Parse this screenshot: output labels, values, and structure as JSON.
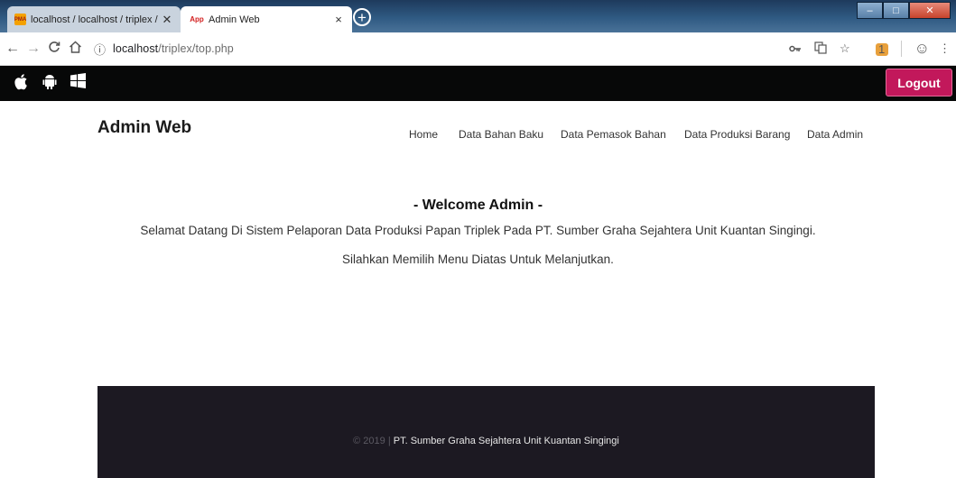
{
  "browser": {
    "tabs": [
      {
        "title": "localhost / localhost / triplex / pr",
        "favicon": "phpmyadmin-icon",
        "close": "✕"
      },
      {
        "title": "Admin Web",
        "favicon": "app-icon",
        "close": "×"
      }
    ],
    "inactive_tab_favicon_text": "PMA",
    "active_tab_favicon_text": "App",
    "address_host": "localhost",
    "address_path": "/triplex/top.php",
    "window_buttons": [
      "–",
      "□",
      "✕"
    ],
    "extension_badge": "1"
  },
  "site": {
    "os_icons": [
      "apple-icon",
      "android-icon",
      "windows-icon"
    ],
    "logout_label": "Logout",
    "brand": "Admin Web",
    "nav": [
      "Home",
      "Data Bahan Baku",
      "Data Pemasok Bahan",
      "Data Produksi Barang",
      "Data Admin"
    ]
  },
  "content": {
    "welcome": "- Welcome Admin -",
    "line1": "Selamat Datang Di Sistem Pelaporan Data Produksi Papan Triplek Pada PT. Sumber Graha Sejahtera Unit Kuantan Singingi.",
    "line2": "Silahkan Memilih Menu Diatas Untuk Melanjutkan."
  },
  "footer": {
    "copyright": "© 2019 |",
    "company": " PT. Sumber Graha Sejahtera Unit Kuantan Singingi"
  },
  "colors": {
    "accent": "#c2185b",
    "top_bar": "#070808",
    "footer_bg": "#1c1922"
  }
}
